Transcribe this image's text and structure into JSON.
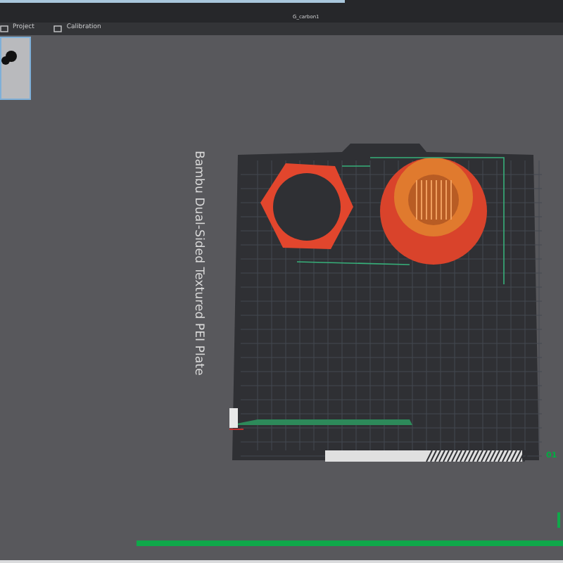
{
  "window": {
    "title": "G_carbon1"
  },
  "tabs": [
    {
      "label": "Project",
      "selected": false
    },
    {
      "label": "Calibration",
      "selected": false
    }
  ],
  "plate": {
    "label": "Bambu Dual-Sided Textured PEI Plate",
    "number": "01"
  }
}
